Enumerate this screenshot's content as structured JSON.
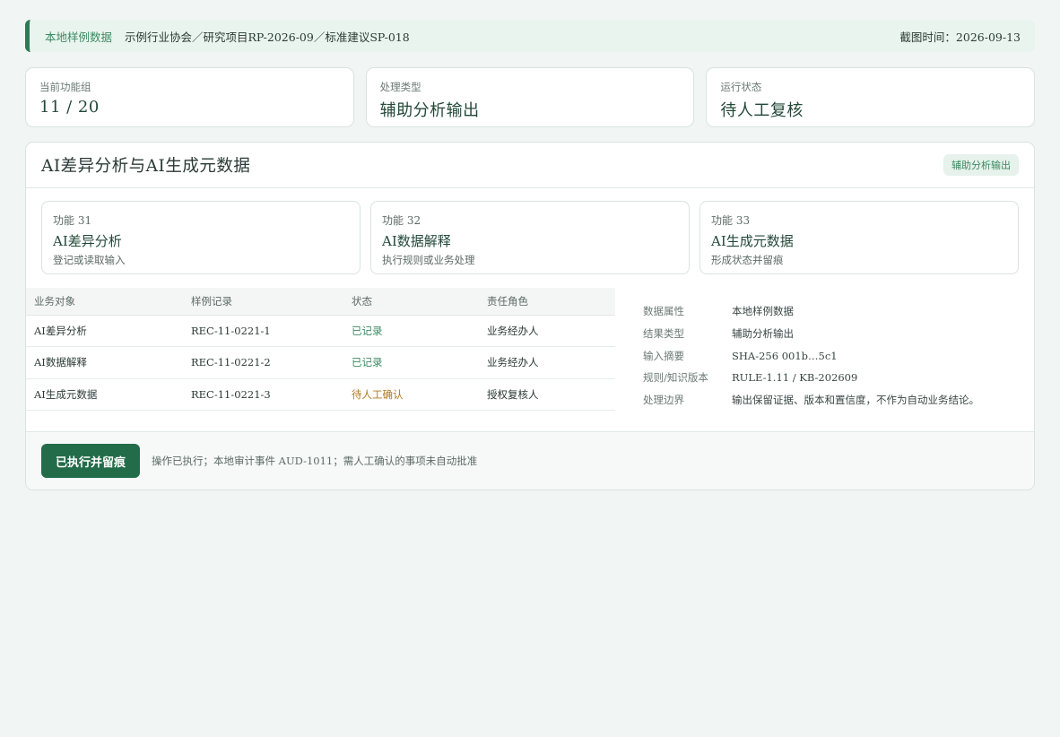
{
  "banner": {
    "tag": "本地样例数据",
    "crumb": "示例行业协会／研究项目RP-2026-09／标准建议SP-018",
    "time": "截图时间：2026-09-13"
  },
  "stats": [
    {
      "label": "当前功能组",
      "value": "11 / 20"
    },
    {
      "label": "处理类型",
      "value": "辅助分析输出"
    },
    {
      "label": "运行状态",
      "value": "待人工复核"
    }
  ],
  "panel": {
    "title": "AI差异分析与AI生成元数据",
    "badge": "辅助分析输出"
  },
  "functions": [
    {
      "num": "功能 31",
      "name": "AI差异分析",
      "desc": "登记或读取输入"
    },
    {
      "num": "功能 32",
      "name": "AI数据解释",
      "desc": "执行规则或业务处理"
    },
    {
      "num": "功能 33",
      "name": "AI生成元数据",
      "desc": "形成状态并留痕"
    }
  ],
  "table": {
    "headers": [
      "业务对象",
      "样例记录",
      "状态",
      "责任角色"
    ],
    "rows": [
      [
        "AI差异分析",
        "REC-11-0221-1",
        "已记录",
        "业务经办人"
      ],
      [
        "AI数据解释",
        "REC-11-0221-2",
        "已记录",
        "业务经办人"
      ],
      [
        "AI生成元数据",
        "REC-11-0221-3",
        "待人工确认",
        "授权复核人"
      ]
    ]
  },
  "props": [
    {
      "k": "数据属性",
      "v": "本地样例数据"
    },
    {
      "k": "结果类型",
      "v": "辅助分析输出"
    },
    {
      "k": "输入摘要",
      "v": "SHA-256 001b…5c1"
    },
    {
      "k": "规则/知识版本",
      "v": "RULE-1.11 / KB-202609"
    },
    {
      "k": "处理边界",
      "v": "输出保留证据、版本和置信度，不作为自动业务结论。"
    }
  ],
  "footer": {
    "button": "已执行并留痕",
    "note": "操作已执行；本地审计事件 AUD-1011；需人工确认的事项未自动批准"
  }
}
